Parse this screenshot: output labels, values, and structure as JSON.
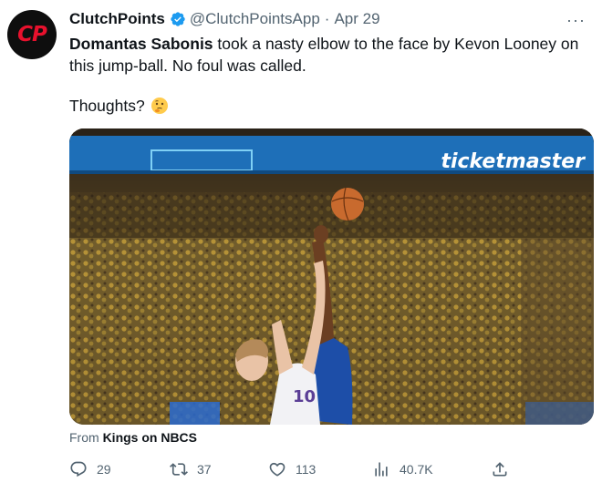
{
  "author": {
    "avatar_text": "CP",
    "name": "ClutchPoints",
    "handle": "@ClutchPointsApp",
    "separator": "·",
    "date": "Apr 29",
    "more_label": "···"
  },
  "tweet": {
    "highlight": "Domantas Sabonis",
    "text_rest": " took a nasty elbow to the face by Kevon Looney on this jump-ball. No foul was called.",
    "question": "Thoughts?",
    "emoji": "thinking-face-icon"
  },
  "media": {
    "banner_text": "ticketmaster",
    "type": "video",
    "content": "basketball jump-ball"
  },
  "attribution": {
    "prefix": "From ",
    "source": "Kings on NBCS"
  },
  "actions": {
    "reply_count": "29",
    "retweet_count": "37",
    "like_count": "113",
    "view_count": "40.7K"
  },
  "colors": {
    "brand_red": "#e8112d",
    "verified_blue": "#1d9bf0",
    "secondary_text": "#536471"
  }
}
